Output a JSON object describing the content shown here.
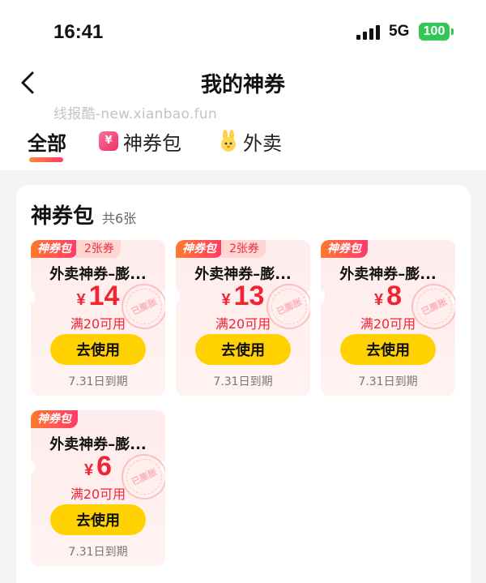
{
  "status_bar": {
    "time": "16:41",
    "network": "5G",
    "battery": "100"
  },
  "nav": {
    "title": "我的神券"
  },
  "watermark": "线报酷-new.xianbao.fun",
  "tabs": [
    {
      "label": "全部",
      "active": true
    },
    {
      "label": "神券包",
      "icon": "coupon-pack-icon",
      "icon_glyph": "¥"
    },
    {
      "label": "外卖",
      "icon": "rabbit-mascot-icon"
    }
  ],
  "section": {
    "title": "神券包",
    "count": "共6张"
  },
  "coupons": [
    {
      "tag": "神券包",
      "count_badge": "2张券",
      "name": "外卖神券–膨...",
      "currency": "¥",
      "amount": "14",
      "condition": "满20可用",
      "stamp": "已膨胀",
      "button": "去使用",
      "expiry": "7.31日到期"
    },
    {
      "tag": "神券包",
      "count_badge": "2张券",
      "name": "外卖神券–膨...",
      "currency": "¥",
      "amount": "13",
      "condition": "满20可用",
      "stamp": "已膨胀",
      "button": "去使用",
      "expiry": "7.31日到期"
    },
    {
      "tag": "神券包",
      "count_badge": "",
      "name": "外卖神券–膨...",
      "currency": "¥",
      "amount": "8",
      "condition": "满20可用",
      "stamp": "已膨胀",
      "button": "去使用",
      "expiry": "7.31日到期"
    },
    {
      "tag": "神券包",
      "count_badge": "",
      "name": "外卖神券–膨...",
      "currency": "¥",
      "amount": "6",
      "condition": "满20可用",
      "stamp": "已膨胀",
      "button": "去使用",
      "expiry": "7.31日到期"
    }
  ],
  "colors": {
    "accent_red": "#f02433",
    "button_yellow": "#ffd100",
    "tag_gradient_start": "#ff7a2e",
    "tag_gradient_end": "#ff3b6b"
  }
}
